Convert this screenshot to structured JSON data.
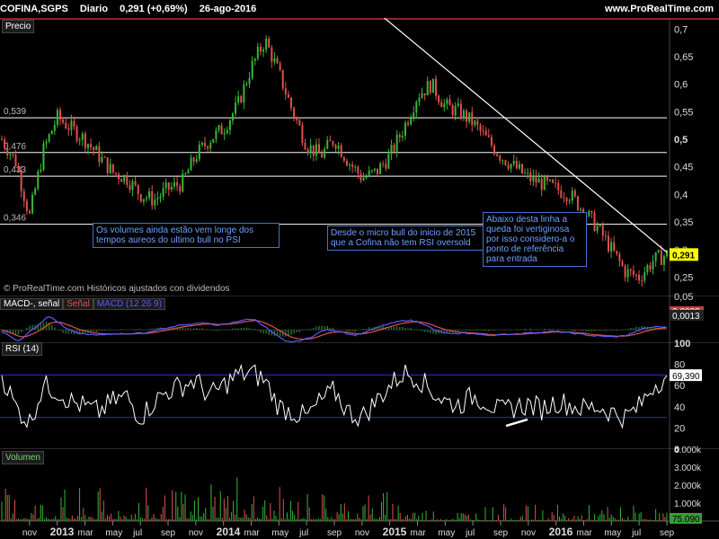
{
  "header": {
    "symbol": "COFINA,SGPS",
    "period": "Diario",
    "last": "0,291 (+0,69%)",
    "date": "26-ago-2016",
    "site": "www.ProRealTime.com"
  },
  "colors": {
    "up": "#36b836",
    "down": "#e05050",
    "hline": "#ffffff",
    "trend": "#ffffff",
    "macd_line": "#5a5aff",
    "signal_line": "#e05050",
    "rsi_line": "#ffffff",
    "rsi_band": "#3030c0",
    "volume": "#36b836",
    "price_tag_bg": "#ffff00"
  },
  "panels": {
    "price_label": "Precio",
    "copyright": "© ProRealTime.com  Históricos ajustados con dividendos",
    "macd_label": "MACD-, señal",
    "macd_signal_label": "Señal",
    "macd_params": "MACD (12 26 9)",
    "rsi_label": "RSI (14)",
    "volume_label": "Volumen"
  },
  "annotations": [
    {
      "text": "Os volumes ainda estão vem longe dos tempos aureos do ultimo bull no PSI"
    },
    {
      "text": "Desde o micro bull do inicio de 2015 que a Cofina não tem RSI oversold"
    },
    {
      "text": "Abaixo desta linha a queda foi vertiginosa por isso considero-a o ponto de referência para entrada"
    }
  ],
  "chart_data": [
    {
      "type": "candlestick",
      "panel": "price",
      "ylim": [
        0.215,
        0.72
      ],
      "y_ticks": [
        "0,7",
        "0,65",
        "0,6",
        "0,55",
        "0,5",
        "0,45",
        "0,4",
        "0,35",
        "0,3",
        "0,25"
      ],
      "y_tick_values": [
        0.7,
        0.65,
        0.6,
        0.55,
        0.5,
        0.45,
        0.4,
        0.35,
        0.3,
        0.25
      ],
      "x_ticks": [
        "nov",
        "2013",
        "mar",
        "may",
        "jul",
        "sep",
        "nov",
        "2014",
        "mar",
        "may",
        "jul",
        "sep",
        "nov",
        "2015",
        "mar",
        "may",
        "jul",
        "sep",
        "nov",
        "2016",
        "mar",
        "may",
        "jul",
        "sep"
      ],
      "horizontal_levels": [
        {
          "value": 0.539,
          "label": "0,539"
        },
        {
          "value": 0.476,
          "label": "0,476"
        },
        {
          "value": 0.433,
          "label": "0,433"
        },
        {
          "value": 0.346,
          "label": "0,346"
        }
      ],
      "trendline": {
        "from": [
          "2015-01",
          0.72
        ],
        "to": [
          "2016-09",
          0.295
        ]
      },
      "last_value": 0.291,
      "last_label": "0,291",
      "close_path": [
        [
          "2012-09",
          0.5
        ],
        [
          "2012-10",
          0.46
        ],
        [
          "2012-11",
          0.36
        ],
        [
          "2012-12",
          0.48
        ],
        [
          "2013-01",
          0.54
        ],
        [
          "2013-02",
          0.52
        ],
        [
          "2013-03",
          0.5
        ],
        [
          "2013-04",
          0.47
        ],
        [
          "2013-05",
          0.44
        ],
        [
          "2013-06",
          0.43
        ],
        [
          "2013-07",
          0.4
        ],
        [
          "2013-08",
          0.39
        ],
        [
          "2013-09",
          0.41
        ],
        [
          "2013-10",
          0.42
        ],
        [
          "2013-11",
          0.47
        ],
        [
          "2013-12",
          0.5
        ],
        [
          "2014-01",
          0.52
        ],
        [
          "2014-02",
          0.56
        ],
        [
          "2014-03",
          0.63
        ],
        [
          "2014-04",
          0.68
        ],
        [
          "2014-05",
          0.62
        ],
        [
          "2014-06",
          0.55
        ],
        [
          "2014-07",
          0.49
        ],
        [
          "2014-08",
          0.47
        ],
        [
          "2014-09",
          0.5
        ],
        [
          "2014-10",
          0.46
        ],
        [
          "2014-11",
          0.43
        ],
        [
          "2014-12",
          0.44
        ],
        [
          "2015-01",
          0.47
        ],
        [
          "2015-02",
          0.52
        ],
        [
          "2015-03",
          0.58
        ],
        [
          "2015-04",
          0.6
        ],
        [
          "2015-05",
          0.56
        ],
        [
          "2015-06",
          0.55
        ],
        [
          "2015-07",
          0.53
        ],
        [
          "2015-08",
          0.5
        ],
        [
          "2015-09",
          0.47
        ],
        [
          "2015-10",
          0.45
        ],
        [
          "2015-11",
          0.43
        ],
        [
          "2015-12",
          0.42
        ],
        [
          "2016-01",
          0.41
        ],
        [
          "2016-02",
          0.4
        ],
        [
          "2016-03",
          0.37
        ],
        [
          "2016-04",
          0.34
        ],
        [
          "2016-05",
          0.3
        ],
        [
          "2016-06",
          0.26
        ],
        [
          "2016-07",
          0.25
        ],
        [
          "2016-08",
          0.28
        ],
        [
          "2016-09",
          0.291
        ]
      ]
    },
    {
      "type": "line",
      "panel": "macd",
      "ylim": [
        -0.02,
        0.05
      ],
      "y_ticks": [
        "0,05"
      ],
      "y_tick_values": [
        0.05
      ],
      "last_values": [
        "0,0038",
        "0,0013"
      ]
    },
    {
      "type": "line",
      "panel": "rsi",
      "ylim": [
        0,
        100
      ],
      "y_ticks": [
        "100",
        "80",
        "60",
        "40",
        "20",
        "0"
      ],
      "y_tick_values": [
        100,
        80,
        60,
        40,
        20,
        0
      ],
      "bands": [
        70,
        30
      ],
      "last_value": "69,390",
      "rsi_path": [
        [
          "2012-09",
          70
        ],
        [
          "2012-10",
          40
        ],
        [
          "2012-11",
          25
        ],
        [
          "2012-12",
          60
        ],
        [
          "2013-01",
          55
        ],
        [
          "2013-02",
          45
        ],
        [
          "2013-03",
          40
        ],
        [
          "2013-04",
          35
        ],
        [
          "2013-05",
          45
        ],
        [
          "2013-06",
          50
        ],
        [
          "2013-07",
          30
        ],
        [
          "2013-08",
          45
        ],
        [
          "2013-09",
          55
        ],
        [
          "2013-10",
          60
        ],
        [
          "2013-11",
          65
        ],
        [
          "2013-12",
          50
        ],
        [
          "2014-01",
          60
        ],
        [
          "2014-02",
          70
        ],
        [
          "2014-03",
          72
        ],
        [
          "2014-04",
          65
        ],
        [
          "2014-05",
          40
        ],
        [
          "2014-06",
          35
        ],
        [
          "2014-07",
          30
        ],
        [
          "2014-08",
          45
        ],
        [
          "2014-09",
          55
        ],
        [
          "2014-10",
          35
        ],
        [
          "2014-11",
          30
        ],
        [
          "2014-12",
          45
        ],
        [
          "2015-01",
          60
        ],
        [
          "2015-02",
          72
        ],
        [
          "2015-03",
          68
        ],
        [
          "2015-04",
          55
        ],
        [
          "2015-05",
          45
        ],
        [
          "2015-06",
          42
        ],
        [
          "2015-07",
          50
        ],
        [
          "2015-08",
          45
        ],
        [
          "2015-09",
          35
        ],
        [
          "2015-10",
          40
        ],
        [
          "2015-11",
          42
        ],
        [
          "2015-12",
          38
        ],
        [
          "2016-01",
          45
        ],
        [
          "2016-02",
          42
        ],
        [
          "2016-03",
          38
        ],
        [
          "2016-04",
          40
        ],
        [
          "2016-05",
          35
        ],
        [
          "2016-06",
          30
        ],
        [
          "2016-07",
          40
        ],
        [
          "2016-08",
          60
        ],
        [
          "2016-09",
          69.39
        ]
      ]
    },
    {
      "type": "bar",
      "panel": "volume",
      "ylim": [
        0,
        4000
      ],
      "y_ticks": [
        "4.000k",
        "3.000k",
        "2.000k",
        "1.000k"
      ],
      "y_tick_values": [
        4000,
        3000,
        2000,
        1000
      ],
      "last_value": "75.090"
    }
  ]
}
